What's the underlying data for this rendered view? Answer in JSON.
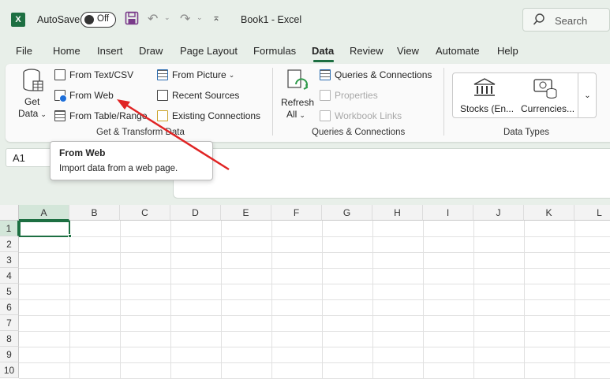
{
  "titlebar": {
    "autosave_label": "AutoSave",
    "toggle_state": "Off",
    "doc_title": "Book1  -  Excel",
    "search_placeholder": "Search"
  },
  "menu": [
    "File",
    "Home",
    "Insert",
    "Draw",
    "Page Layout",
    "Formulas",
    "Data",
    "Review",
    "View",
    "Automate",
    "Help"
  ],
  "active_menu": "Data",
  "ribbon": {
    "get_transform": {
      "get_data_line1": "Get",
      "get_data_line2": "Data",
      "from_text_csv": "From Text/CSV",
      "from_web": "From Web",
      "from_table_range": "From Table/Range",
      "from_picture": "From Picture",
      "recent_sources": "Recent Sources",
      "existing_connections": "Existing Connections",
      "group_label": "Get & Transform Data"
    },
    "queries": {
      "refresh_line1": "Refresh",
      "refresh_line2": "All",
      "queries_connections": "Queries & Connections",
      "properties": "Properties",
      "workbook_links": "Workbook Links",
      "group_label": "Queries & Connections"
    },
    "data_types": {
      "stocks": "Stocks (En...",
      "currencies": "Currencies...",
      "group_label": "Data Types"
    }
  },
  "name_box": "A1",
  "tooltip": {
    "title": "From Web",
    "body": "Import data from a web page."
  },
  "sheet": {
    "columns": [
      "A",
      "B",
      "C",
      "D",
      "E",
      "F",
      "G",
      "H",
      "I",
      "J",
      "K",
      "L"
    ],
    "rows": [
      "1",
      "2",
      "3",
      "4",
      "5",
      "6",
      "7",
      "8",
      "9",
      "10"
    ],
    "active_cell": "A1"
  },
  "colors": {
    "excel_green": "#1d6f42",
    "arrow_red": "#e02424",
    "chrome_bg": "#e8efe9"
  }
}
